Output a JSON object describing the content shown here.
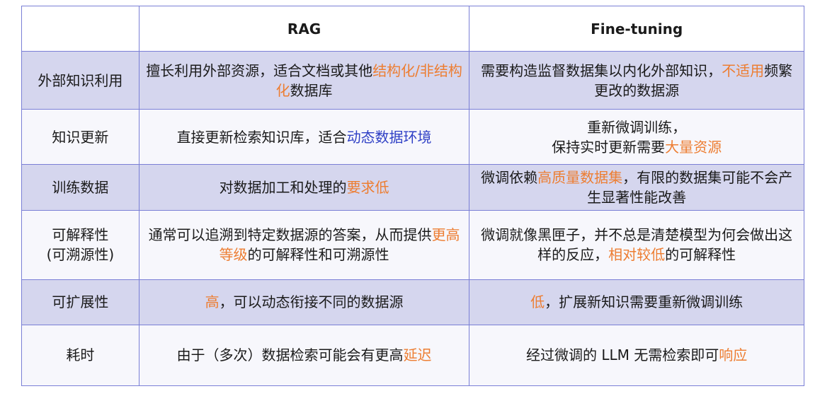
{
  "header": {
    "col0": "",
    "col1": "RAG",
    "col2": "Fine-tuning"
  },
  "colors": {
    "border": "#7a7fd6",
    "shaded_row": "#d5d6ee",
    "highlight_orange": "#ed7d31",
    "highlight_blue": "#2e3fc5"
  },
  "rows": [
    {
      "label": "外部知识利用",
      "rag": {
        "a": "擅长利用外部资源，适合文档或其他",
        "hl": "结构化/非结构化",
        "b": "数据库"
      },
      "ft": {
        "a": "需要构造监督数据集以内化外部知识，",
        "hl": "不适用",
        "b": "频繁更改的数据源"
      }
    },
    {
      "label": "知识更新",
      "rag": {
        "a": "直接更新检索知识库，适合",
        "hl": "动态数据环境",
        "b": ""
      },
      "ft": {
        "line1": "重新微调训练，",
        "a": "保持实时更新需要",
        "hl": "大量资源",
        "b": ""
      }
    },
    {
      "label": "训练数据",
      "rag": {
        "a": "对数据加工和处理的",
        "hl": "要求低",
        "b": ""
      },
      "ft": {
        "a": "微调依赖",
        "hl": "高质量数据集",
        "b": "，有限的数据集可能不会产生显著性能改善"
      }
    },
    {
      "label": "可解释性",
      "label2": "(可溯源性)",
      "rag": {
        "a": "通常可以追溯到特定数据源的答案，从而提供",
        "hl": "更高等级",
        "b": "的可解释性和可溯源性"
      },
      "ft": {
        "a": "微调就像黑匣子，并不总是清楚模型为何会做出这样的反应，",
        "hl": "相对较低",
        "b": "的可解释性"
      }
    },
    {
      "label": "可扩展性",
      "rag": {
        "a": "",
        "hl": "高",
        "b": "，可以动态衔接不同的数据源"
      },
      "ft": {
        "a": "",
        "hl": "低",
        "b": "，扩展新知识需要重新微调训练"
      }
    },
    {
      "label": "耗时",
      "rag": {
        "a": "由于（多次）数据检索可能会有更高",
        "hl": "延迟",
        "b": ""
      },
      "ft": {
        "a": "经过微调的 LLM 无需检索即可",
        "hl": "响应",
        "b": ""
      }
    }
  ]
}
